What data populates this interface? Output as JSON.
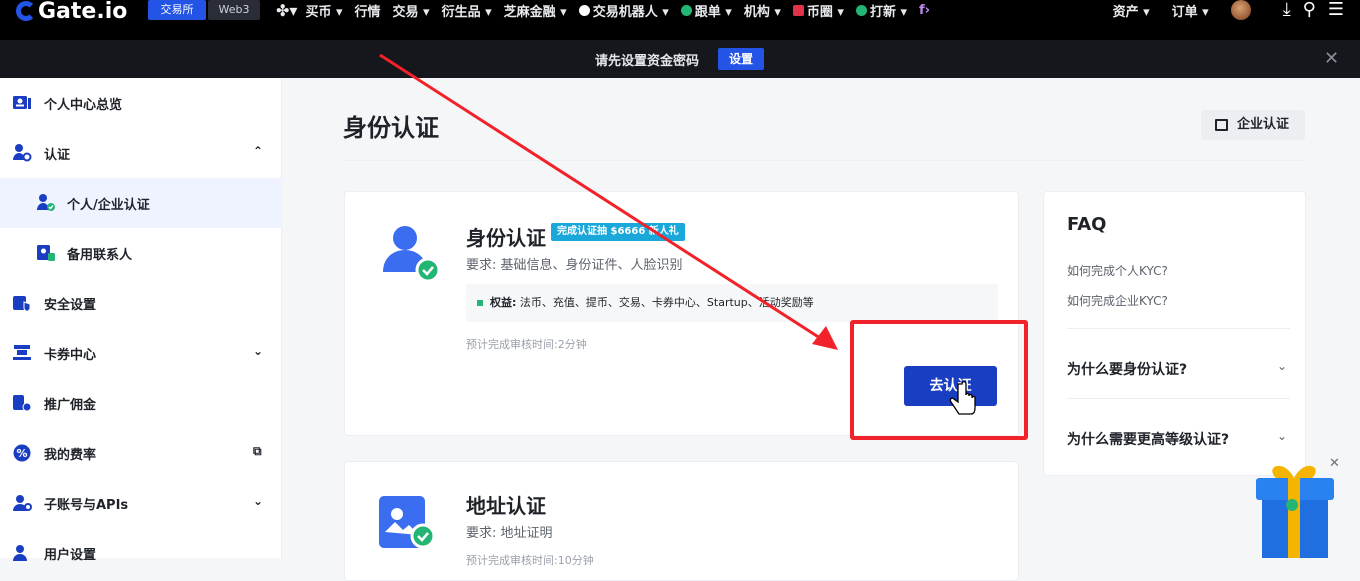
{
  "topnav": {
    "logo": "Gate.io",
    "tab_exchange": "交易所",
    "tab_web3": "Web3",
    "menu": [
      "买币 ▾",
      "行情",
      "交易 ▾",
      "衍生品 ▾",
      "芝麻金融 ▾",
      "交易机器人 ▾",
      "跟单 ▾",
      "机构 ▾",
      "币圈 ▾",
      "打新 ▾"
    ],
    "right": [
      "资产 ▾",
      "订单 ▾"
    ]
  },
  "banner": {
    "text": "请先设置资金密码",
    "button": "设置"
  },
  "sidebar": {
    "items": [
      {
        "label": "个人中心总览"
      },
      {
        "label": "认证"
      },
      {
        "label": "个人/企业认证"
      },
      {
        "label": "备用联系人"
      },
      {
        "label": "安全设置"
      },
      {
        "label": "卡券中心"
      },
      {
        "label": "推广佣金"
      },
      {
        "label": "我的费率"
      },
      {
        "label": "子账号与APIs"
      },
      {
        "label": "用户设置"
      }
    ]
  },
  "main": {
    "title": "身份认证",
    "enterprise_button": "企业认证",
    "identity_card": {
      "title": "身份认证",
      "badge": "完成认证抽 $6666 新人礼",
      "requirement": "要求: 基础信息、身份证件、人脸识别",
      "benefit_label": "权益:",
      "benefit_text": "法币、充值、提币、交易、卡券中心、Startup、活动奖励等",
      "estimate": "预计完成审核时间:2分钟",
      "button": "去认证"
    },
    "address_card": {
      "title": "地址认证",
      "requirement": "要求: 地址证明",
      "estimate": "预计完成审核时间:10分钟"
    },
    "faq": {
      "title": "FAQ",
      "links": [
        "如何完成个人KYC?",
        "如何完成企业KYC?"
      ],
      "questions": [
        "为什么要身份认证?",
        "为什么需要更高等级认证?"
      ]
    }
  },
  "colors": {
    "brand_blue": "#2354e6",
    "button_blue": "#1a3ec2",
    "annotation_red": "#f2222a",
    "badge_cyan": "#1aa7d9"
  }
}
